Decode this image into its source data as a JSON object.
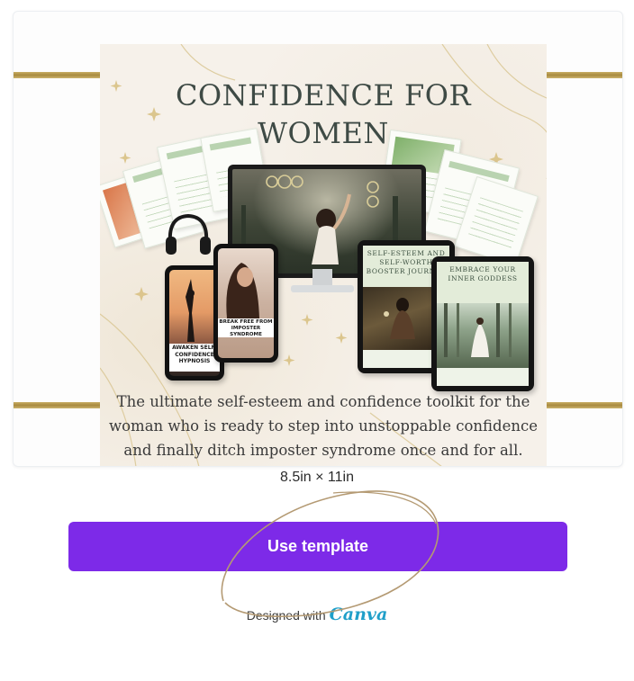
{
  "preview": {
    "title_line1": "CONFIDENCE FOR",
    "title_line2": "WOMEN",
    "description": "The ultimate self-esteem and confidence toolkit for the woman who is ready to step into unstoppable confidence and finally ditch imposter syndrome once and for all.",
    "tablet_self_esteem": "SELF-ESTEEM AND SELF-WORTH BOOSTER JOURNAL",
    "tablet_goddess": "EMBRACE YOUR INNER GODDESS",
    "phone_awaken": "AWAKEN SELF-CONFIDENCE HYPNOSIS",
    "phone_imposter": "BREAK FREE FROM IMPOSTER SYNDROME"
  },
  "template": {
    "dimensions": "8.5in × 11in",
    "use_button_label": "Use template",
    "designed_with": "Designed with",
    "brand_name": "Canva"
  },
  "colors": {
    "button": "#7d2ae8",
    "brand": "#1f9fc9",
    "gold_band": "#b99a4f"
  }
}
